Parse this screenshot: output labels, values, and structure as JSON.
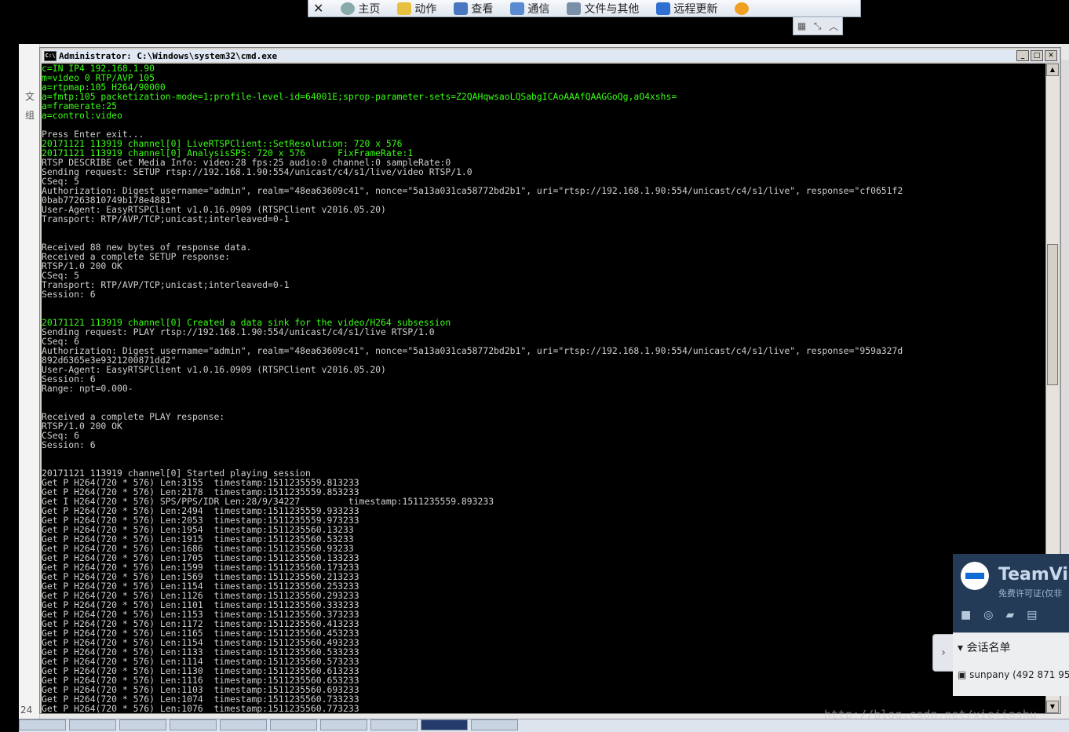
{
  "tv_toolbar": {
    "items": [
      {
        "label": "主页",
        "icon": "home-icon"
      },
      {
        "label": "动作",
        "icon": "lightning-icon"
      },
      {
        "label": "查看",
        "icon": "view-icon"
      },
      {
        "label": "通信",
        "icon": "phone-icon"
      },
      {
        "label": "文件与其他",
        "icon": "files-icon"
      },
      {
        "label": "远程更新",
        "icon": "download-icon"
      }
    ]
  },
  "left_strip": {
    "labels": [
      "文",
      "组"
    ],
    "bottom": "24"
  },
  "cmd": {
    "title": "Administrator: C:\\Windows\\system32\\cmd.exe",
    "icon_label": "C:\\"
  },
  "console_lines": [
    {
      "t": "c=IN IP4 192.168.1.90",
      "g": true
    },
    {
      "t": "m=video 0 RTP/AVP 105",
      "g": true
    },
    {
      "t": "a=rtpmap:105 H264/90000",
      "g": true
    },
    {
      "t": "a=fmtp:105 packetization-mode=1;profile-level-id=64001E;sprop-parameter-sets=Z2QAHqwsaoLQSabgICAoAAAfQAAGGoQg,aO4xshs=",
      "g": true
    },
    {
      "t": "a=framerate:25",
      "g": true
    },
    {
      "t": "a=control:video",
      "g": true
    },
    {
      "t": "",
      "g": false
    },
    {
      "t": "Press Enter exit...",
      "g": false
    },
    {
      "t": "20171121 113919 channel[0] LiveRTSPClient::SetResolution: 720 x 576",
      "g": true
    },
    {
      "t": "20171121 113919 channel[0] AnalysisSPS: 720 x 576      FixFrameRate:1",
      "g": true
    },
    {
      "t": "RTSP DESCRIBE Get Media Info: video:28 fps:25 audio:0 channel:0 sampleRate:0",
      "g": false
    },
    {
      "t": "Sending request: SETUP rtsp://192.168.1.90:554/unicast/c4/s1/live/video RTSP/1.0",
      "g": false
    },
    {
      "t": "CSeq: 5",
      "g": false
    },
    {
      "t": "Authorization: Digest username=\"admin\", realm=\"48ea63609c41\", nonce=\"5a13a031ca58772bd2b1\", uri=\"rtsp://192.168.1.90:554/unicast/c4/s1/live\", response=\"cf0651f2",
      "g": false
    },
    {
      "t": "0bab77263810749b178e4881\"",
      "g": false
    },
    {
      "t": "User-Agent: EasyRTSPClient v1.0.16.0909 (RTSPClient v2016.05.20)",
      "g": false
    },
    {
      "t": "Transport: RTP/AVP/TCP;unicast;interleaved=0-1",
      "g": false
    },
    {
      "t": "",
      "g": false
    },
    {
      "t": "",
      "g": false
    },
    {
      "t": "Received 88 new bytes of response data.",
      "g": false
    },
    {
      "t": "Received a complete SETUP response:",
      "g": false
    },
    {
      "t": "RTSP/1.0 200 OK",
      "g": false
    },
    {
      "t": "CSeq: 5",
      "g": false
    },
    {
      "t": "Transport: RTP/AVP/TCP;unicast;interleaved=0-1",
      "g": false
    },
    {
      "t": "Session: 6",
      "g": false
    },
    {
      "t": "",
      "g": false
    },
    {
      "t": "",
      "g": false
    },
    {
      "t": "20171121 113919 channel[0] Created a data sink for the video/H264 subsession",
      "g": true
    },
    {
      "t": "Sending request: PLAY rtsp://192.168.1.90:554/unicast/c4/s1/live RTSP/1.0",
      "g": false
    },
    {
      "t": "CSeq: 6",
      "g": false
    },
    {
      "t": "Authorization: Digest username=\"admin\", realm=\"48ea63609c41\", nonce=\"5a13a031ca58772bd2b1\", uri=\"rtsp://192.168.1.90:554/unicast/c4/s1/live\", response=\"959a327d",
      "g": false
    },
    {
      "t": "892d6365e3e9321200871dd2\"",
      "g": false
    },
    {
      "t": "User-Agent: EasyRTSPClient v1.0.16.0909 (RTSPClient v2016.05.20)",
      "g": false
    },
    {
      "t": "Session: 6",
      "g": false
    },
    {
      "t": "Range: npt=0.000-",
      "g": false
    },
    {
      "t": "",
      "g": false
    },
    {
      "t": "",
      "g": false
    },
    {
      "t": "Received a complete PLAY response:",
      "g": false
    },
    {
      "t": "RTSP/1.0 200 OK",
      "g": false
    },
    {
      "t": "CSeq: 6",
      "g": false
    },
    {
      "t": "Session: 6",
      "g": false
    },
    {
      "t": "",
      "g": false
    },
    {
      "t": "",
      "g": false
    },
    {
      "t": "20171121 113919 channel[0] Started playing session",
      "g": false
    },
    {
      "t": "Get P H264(720 * 576) Len:3155  timestamp:1511235559.813233",
      "g": false
    },
    {
      "t": "Get P H264(720 * 576) Len:2178  timestamp:1511235559.853233",
      "g": false
    },
    {
      "t": "Get I H264(720 * 576) SPS/PPS/IDR Len:28/9/34227         timestamp:1511235559.893233",
      "g": false
    },
    {
      "t": "Get P H264(720 * 576) Len:2494  timestamp:1511235559.933233",
      "g": false
    },
    {
      "t": "Get P H264(720 * 576) Len:2053  timestamp:1511235559.973233",
      "g": false
    },
    {
      "t": "Get P H264(720 * 576) Len:1954  timestamp:1511235560.13233",
      "g": false
    },
    {
      "t": "Get P H264(720 * 576) Len:1915  timestamp:1511235560.53233",
      "g": false
    },
    {
      "t": "Get P H264(720 * 576) Len:1686  timestamp:1511235560.93233",
      "g": false
    },
    {
      "t": "Get P H264(720 * 576) Len:1705  timestamp:1511235560.133233",
      "g": false
    },
    {
      "t": "Get P H264(720 * 576) Len:1599  timestamp:1511235560.173233",
      "g": false
    },
    {
      "t": "Get P H264(720 * 576) Len:1569  timestamp:1511235560.213233",
      "g": false
    },
    {
      "t": "Get P H264(720 * 576) Len:1154  timestamp:1511235560.253233",
      "g": false
    },
    {
      "t": "Get P H264(720 * 576) Len:1126  timestamp:1511235560.293233",
      "g": false
    },
    {
      "t": "Get P H264(720 * 576) Len:1101  timestamp:1511235560.333233",
      "g": false
    },
    {
      "t": "Get P H264(720 * 576) Len:1153  timestamp:1511235560.373233",
      "g": false
    },
    {
      "t": "Get P H264(720 * 576) Len:1172  timestamp:1511235560.413233",
      "g": false
    },
    {
      "t": "Get P H264(720 * 576) Len:1165  timestamp:1511235560.453233",
      "g": false
    },
    {
      "t": "Get P H264(720 * 576) Len:1154  timestamp:1511235560.493233",
      "g": false
    },
    {
      "t": "Get P H264(720 * 576) Len:1133  timestamp:1511235560.533233",
      "g": false
    },
    {
      "t": "Get P H264(720 * 576) Len:1114  timestamp:1511235560.573233",
      "g": false
    },
    {
      "t": "Get P H264(720 * 576) Len:1130  timestamp:1511235560.613233",
      "g": false
    },
    {
      "t": "Get P H264(720 * 576) Len:1116  timestamp:1511235560.653233",
      "g": false
    },
    {
      "t": "Get P H264(720 * 576) Len:1103  timestamp:1511235560.693233",
      "g": false
    },
    {
      "t": "Get P H264(720 * 576) Len:1074  timestamp:1511235560.733233",
      "g": false
    },
    {
      "t": "Get P H264(720 * 576) Len:1076  timestamp:1511235560.773233",
      "g": false
    }
  ],
  "teamviewer": {
    "name": "TeamVie",
    "subtitle": "免费许可证(仅非",
    "session_list_label": "会话名单",
    "user": "sunpany (492 871 95"
  },
  "watermark": "http://blog.csdn.net/xiejiashu",
  "colors": {
    "console_green": "#39ff14",
    "console_text": "#d0d0d0",
    "tv_blue": "#243b57"
  }
}
